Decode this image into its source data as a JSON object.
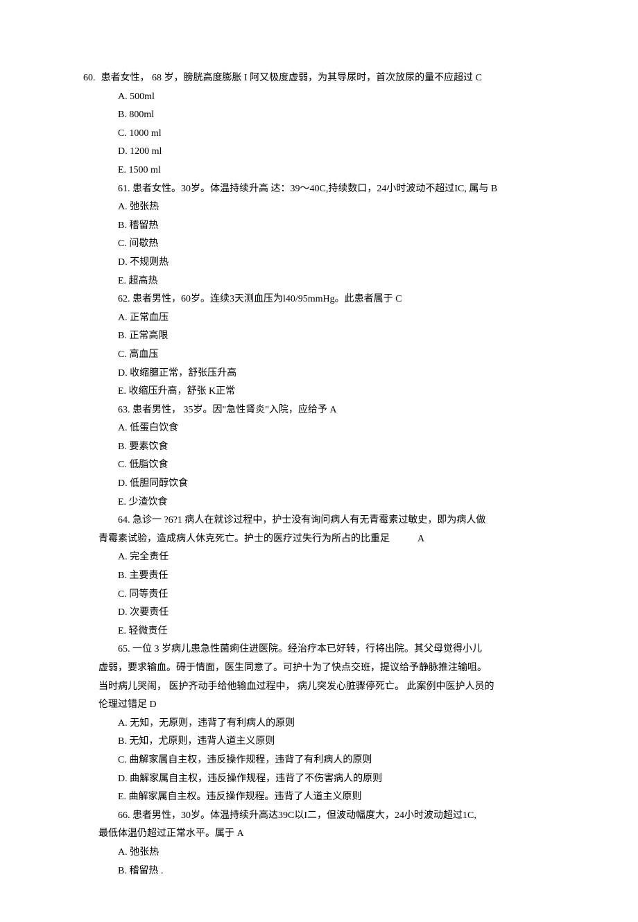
{
  "q60": {
    "num": "60.",
    "stem": "患者女性， 68 岁，膀胱高度膨胀 I 阿又极度虚弱，为其导尿时，首次放尿的量不应超过 C",
    "opts": {
      "A": "A.    500ml",
      "B": "B.    800ml",
      "C": "C.    1000 ml",
      "D": "D.    1200 ml",
      "E": "E.    1500 ml"
    }
  },
  "q61": {
    "stem": "61.  患者女性。30岁。体温持续升高  达：39～40C,持续数口，24小时波动不超过IC, 属与  B",
    "opts": {
      "A": "A.  弛张热",
      "B": "B.  稽留热",
      "C": "C.  间歇热",
      "D": "D.  不规则热",
      "E": "E.  超高热"
    }
  },
  "q62": {
    "stem": "62.  患者男性，60岁。连续3天测血压为l40/95mmHg。此患者属于  C",
    "opts": {
      "A": "A.  正常血压",
      "B": "B.  正常高限",
      "C": "C.  高血压",
      "D": "D.  收缩膻正常，舒张压升高",
      "E": "E.  收缩压升高，舒张  K正常"
    }
  },
  "q63": {
    "stem": "63.  患者男性， 35岁。因\"急性肾炎\"入院，应给予  A",
    "opts": {
      "A": "A.  低蛋白饮食",
      "B": "B.  要素饮食",
      "C": "C.  低脂饮食",
      "D": "D.  低胆同醇饮食",
      "E": "E.  少渣饮食"
    }
  },
  "q64": {
    "stem1": "64.  急诊一  ?6?1 病人在就诊过程中，护士没有询问病人有无青霉素过敏史，即为病人做",
    "stem2_a": "青霉素试验，造成病人休克死亡。护士的医疗过失行为所占的比重足",
    "stem2_b": "A",
    "opts": {
      "A": "A.  完全责任",
      "B": "B.  主要责任",
      "C": "C.  同等责任",
      "D": "D.  次要责任",
      "E": "E.  轻微责任"
    }
  },
  "q65": {
    "stem1": "65.  一位  3 岁病儿患急性菌痢住进医院。经治疗本已好转，行将出院。其父母觉得小儿",
    "stem2": "虚弱，要求输血。碍于情面，医生同意了。可护十为了快点交班，提议给予静脉推注输咀。",
    "stem3": "当时病儿哭闹， 医护齐动手给他输血过程中， 病儿突发心脏骤停死亡。 此案例中医护人员的",
    "stem4": "伦理过错足  D",
    "opts": {
      "A": "A.  无知，无原则，违背了有利病人的原则",
      "B": "B.  无知，尤原则，违背人道主义原则",
      "C": "C.  曲解家属自主权，违反操作规程，违背了有利病人的原则",
      "D": "D.  曲解家属自主权，违反操作规程，违背了不伤害病人的原则",
      "E": "E.  曲解家属自主权。违反操作规程。违背了人道主义原则"
    }
  },
  "q66": {
    "stem1": "66.  患者男性，30岁。体温持续升高达39C以I二，但波动幅度大，24小时波动超过1C,",
    "stem2": "最低体温仍超过正常水平。属于  A",
    "opts": {
      "A": "A.  弛张热",
      "B": "B.  稽留热  ."
    }
  }
}
